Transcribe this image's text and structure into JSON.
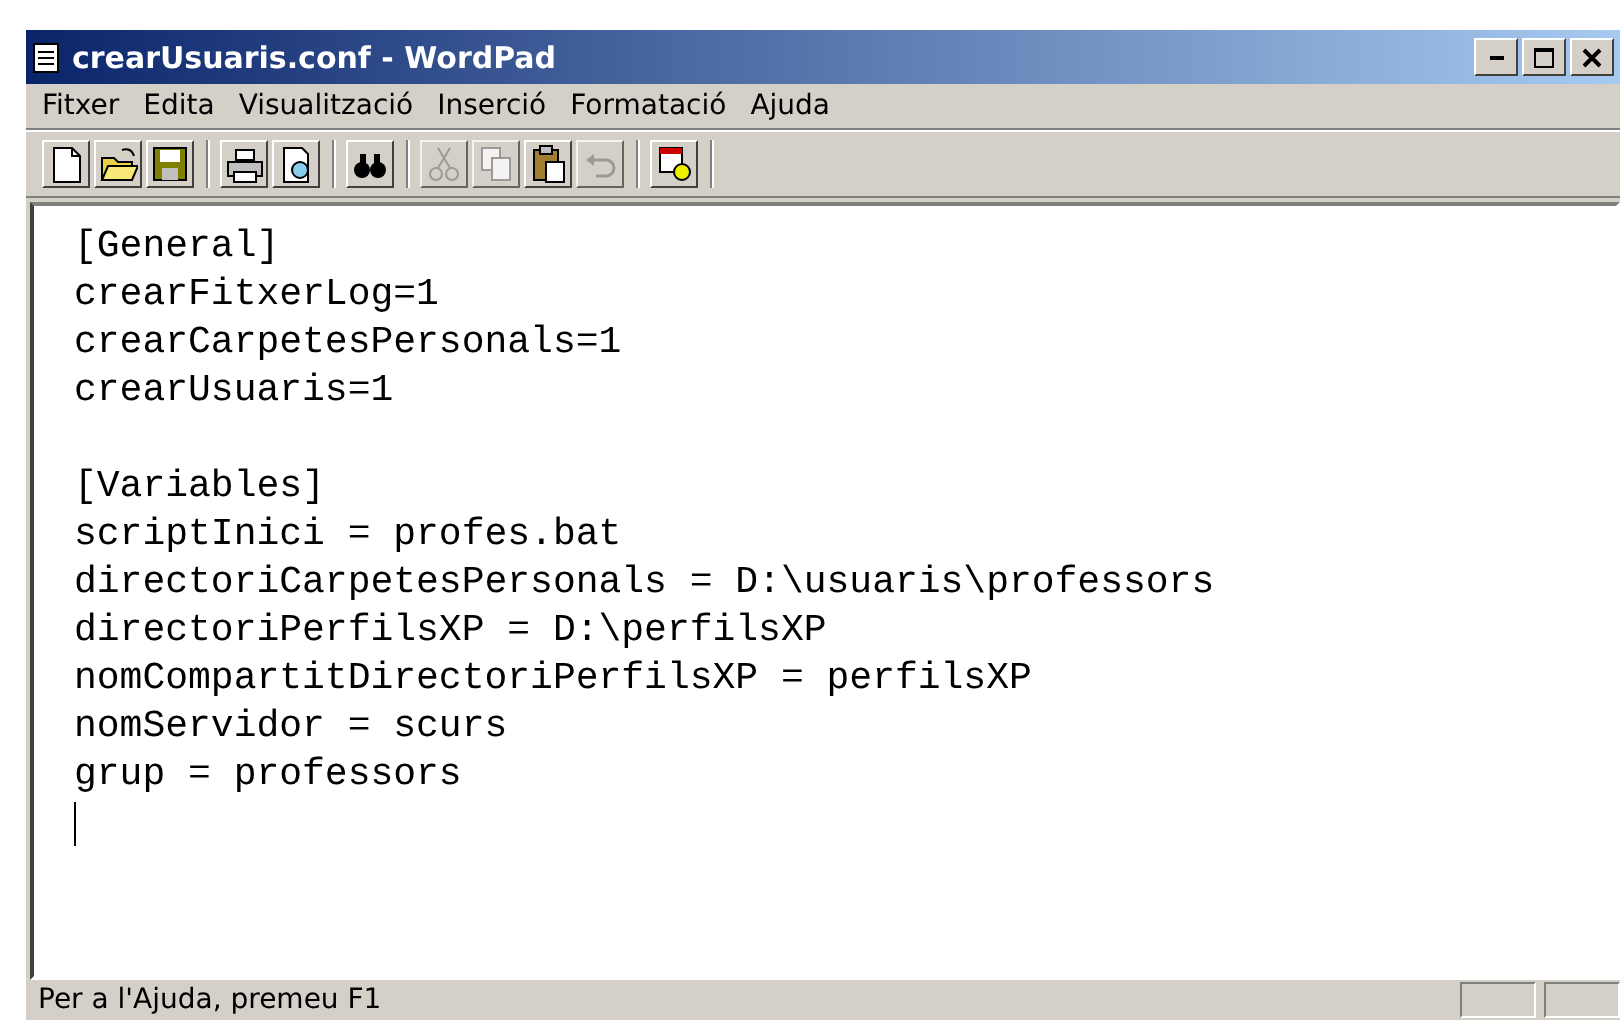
{
  "window": {
    "title": "crearUsuaris.conf - WordPad"
  },
  "menu": [
    "Fitxer",
    "Edita",
    "Visualització",
    "Inserció",
    "Formatació",
    "Ajuda"
  ],
  "toolbar": [
    [
      {
        "kind": "new",
        "disabled": false
      },
      {
        "kind": "open",
        "disabled": false
      },
      {
        "kind": "save",
        "disabled": false
      }
    ],
    [
      {
        "kind": "print",
        "disabled": false
      },
      {
        "kind": "preview",
        "disabled": false
      }
    ],
    [
      {
        "kind": "find",
        "disabled": false
      }
    ],
    [
      {
        "kind": "cut",
        "disabled": true
      },
      {
        "kind": "copy",
        "disabled": true
      },
      {
        "kind": "paste",
        "disabled": false
      },
      {
        "kind": "undo",
        "disabled": true
      }
    ],
    [
      {
        "kind": "datetime",
        "disabled": false
      }
    ]
  ],
  "document": {
    "sections": [
      [
        "[General]",
        "crearFitxerLog=1",
        "crearCarpetesPersonals=1",
        "crearUsuaris=1"
      ],
      [
        "[Variables]",
        "scriptInici = profes.bat",
        "directoriCarpetesPersonals = D:\\usuaris\\professors",
        "directoriPerfilsXP = D:\\perfilsXP",
        "nomCompartitDirectoriPerfilsXP = perfilsXP",
        "nomServidor = scurs",
        "grup = professors"
      ]
    ]
  },
  "status_bar": {
    "text": "Per a l'Ajuda, premeu F1"
  }
}
